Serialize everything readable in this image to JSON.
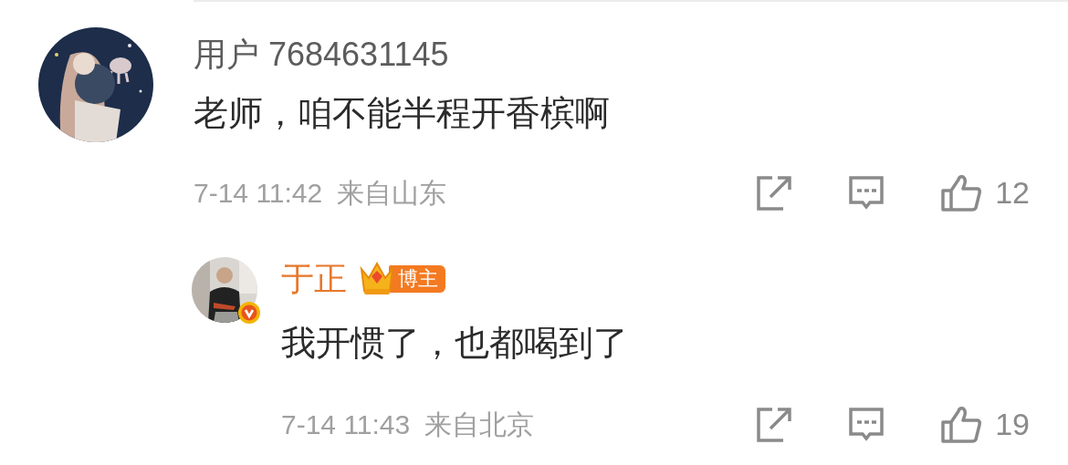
{
  "comments": [
    {
      "user": "用户 7684631145",
      "author": false,
      "verified": false,
      "text": "老师，咱不能半程开香槟啊",
      "time": "7-14 11:42",
      "location": "来自山东",
      "likes": "12"
    },
    {
      "user": "于正",
      "author": true,
      "badge": "博主",
      "verified": true,
      "text": "我开惯了，也都喝到了",
      "time": "7-14 11:43",
      "location": "来自北京",
      "likes": "19"
    }
  ]
}
